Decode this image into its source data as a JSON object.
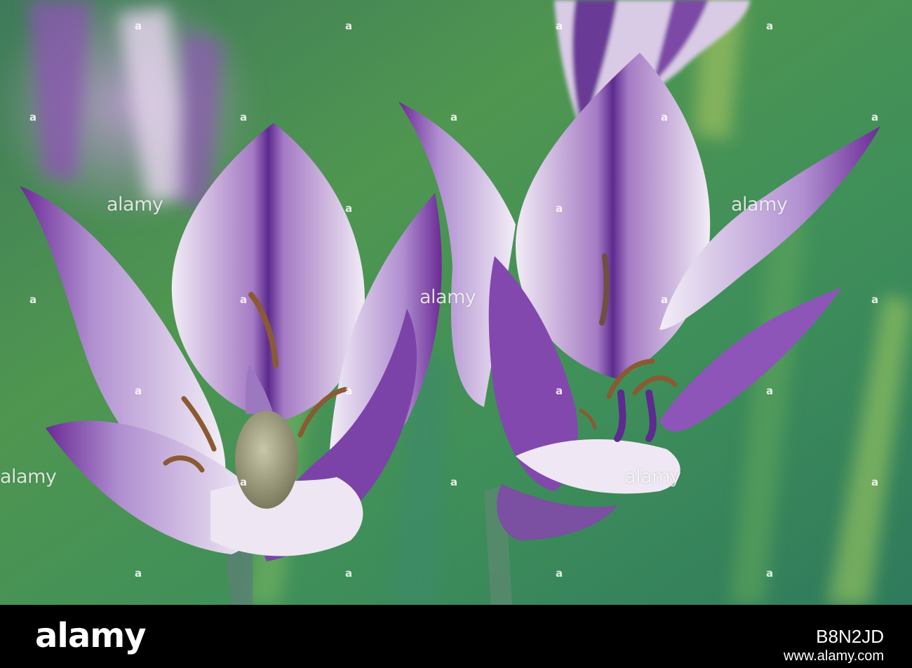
{
  "photo": {
    "subject": "Two purple and white striped lily flowers against a green background",
    "colors": {
      "petal_white": "#f4ecf6",
      "petal_purple": "#6b2a96",
      "leaf_green": "#3f9a56"
    }
  },
  "watermark": {
    "text": "alamy",
    "marker": "a"
  },
  "footer": {
    "logo": "alamy",
    "image_id": "B8N2JD",
    "website": "www.alamy.com"
  }
}
